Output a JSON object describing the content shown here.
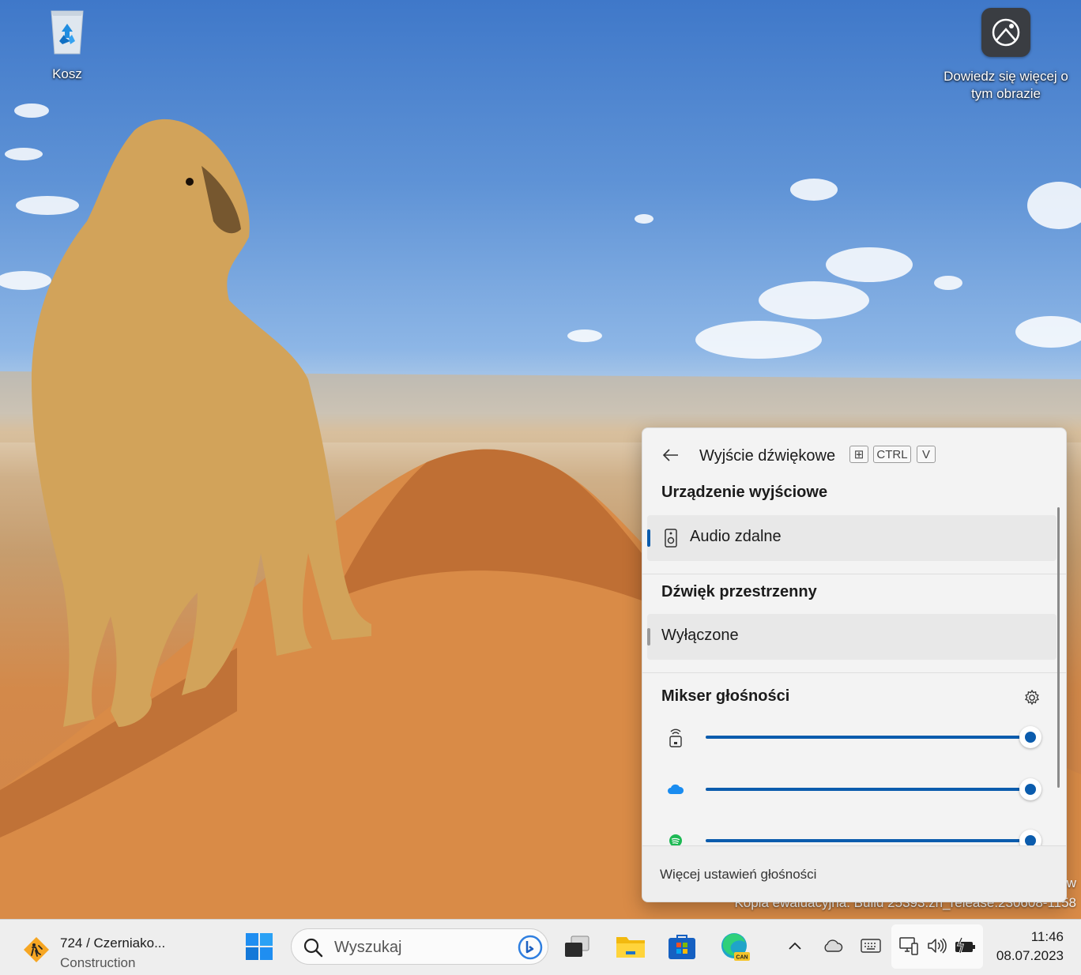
{
  "desktop": {
    "icons": {
      "recycle_bin": "Kosz",
      "learn_more_line1": "Dowiedz się więcej o",
      "learn_more_line2": "tym obrazie"
    },
    "watermark": {
      "line1": "w",
      "line2": "Kopia ewaluacyjna. Build 25393.zn_release.230608-1158"
    }
  },
  "flyout": {
    "title": "Wyjście dźwiękowe",
    "shortcut_keys": [
      "⊞",
      "CTRL",
      "V"
    ],
    "output_device": {
      "heading": "Urządzenie wyjściowe",
      "selected": "Audio zdalne"
    },
    "spatial_sound": {
      "heading": "Dźwięk przestrzenny",
      "selected": "Wyłączone"
    },
    "mixer": {
      "heading": "Mikser głośności",
      "apps": [
        {
          "icon": "remote-audio-icon",
          "volume_percent": 100
        },
        {
          "icon": "onedrive-icon",
          "volume_percent": 100
        },
        {
          "icon": "spotify-icon",
          "volume_percent": 100
        }
      ]
    },
    "footer_link": "Więcej ustawień głośności"
  },
  "taskbar": {
    "widget": {
      "line1": "724 / Czerniako...",
      "line2": "Construction"
    },
    "search_placeholder": "Wyszukaj",
    "clock": {
      "time": "11:46",
      "date": "08.07.2023"
    }
  },
  "colors": {
    "accent": "#0b5cad",
    "flyout_bg": "#f3f3f3",
    "taskbar_bg": "#eeeeee"
  }
}
